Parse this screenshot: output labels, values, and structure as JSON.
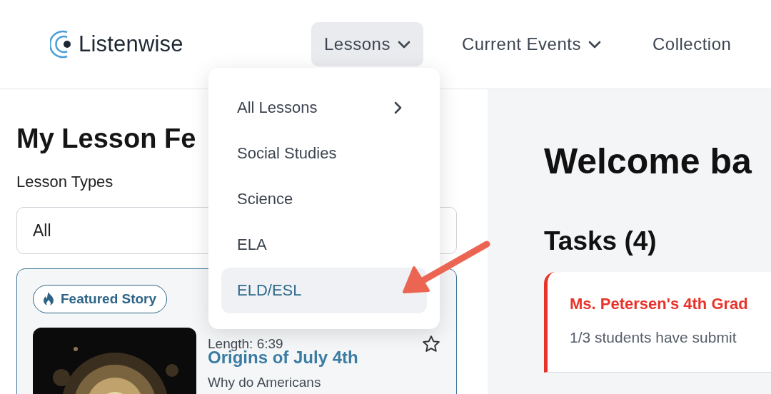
{
  "logo": {
    "text": "Listenwise"
  },
  "nav": [
    {
      "label": "Lessons",
      "selected": true,
      "has_menu": true
    },
    {
      "label": "Current Events",
      "selected": false,
      "has_menu": true
    },
    {
      "label": "Collection",
      "selected": false,
      "has_menu": false
    }
  ],
  "lessons_menu": {
    "items": [
      {
        "label": "All Lessons",
        "selected": false,
        "submenu": true
      },
      {
        "label": "Social Studies",
        "selected": false,
        "submenu": false
      },
      {
        "label": "Science",
        "selected": false,
        "submenu": false
      },
      {
        "label": "ELA",
        "selected": false,
        "submenu": false
      },
      {
        "label": "ELD/ESL",
        "selected": true,
        "submenu": false
      }
    ]
  },
  "lesson_feed": {
    "title": "My Lesson Fe",
    "filter_label": "Lesson Types",
    "filter_value": "All",
    "featured": {
      "badge": "Featured Story",
      "length": "Length: 6:39",
      "title": "Origins of July 4th",
      "summary": "Why do Americans",
      "starred": false
    }
  },
  "main": {
    "welcome": "Welcome ba",
    "tasks_title": "Tasks (4)",
    "tasks": [
      {
        "title": "Ms. Petersen's 4th Grad",
        "status": "1/3 students have submit",
        "color": "#e8332a"
      }
    ]
  }
}
